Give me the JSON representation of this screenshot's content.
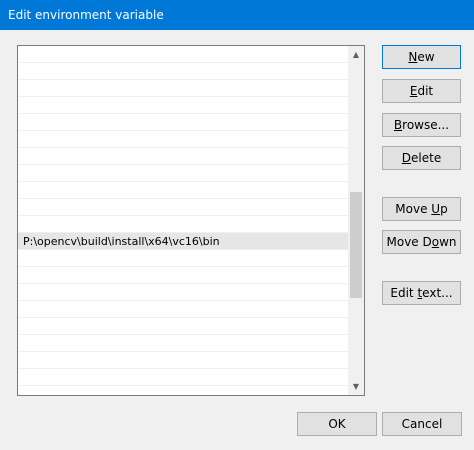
{
  "window": {
    "title": "Edit environment variable"
  },
  "list": {
    "rows": [
      "",
      "",
      "",
      "",
      "",
      "",
      "",
      "",
      "",
      "",
      "",
      "P:\\opencv\\build\\install\\x64\\vc16\\bin",
      "",
      "",
      "",
      "",
      "",
      "",
      "",
      "",
      ""
    ],
    "selected_index": 11
  },
  "buttons": {
    "new": {
      "pre": "",
      "mn": "N",
      "post": "ew"
    },
    "edit": {
      "pre": "",
      "mn": "E",
      "post": "dit"
    },
    "browse": {
      "pre": "",
      "mn": "B",
      "post": "rowse..."
    },
    "delete": {
      "pre": "",
      "mn": "D",
      "post": "elete"
    },
    "move_up": {
      "pre": "Move ",
      "mn": "U",
      "post": "p"
    },
    "move_down": {
      "pre": "Move D",
      "mn": "o",
      "post": "wn"
    },
    "edit_text": {
      "pre": "Edit ",
      "mn": "t",
      "post": "ext..."
    },
    "ok": "OK",
    "cancel": "Cancel"
  },
  "colors": {
    "titlebar": "#0078d7",
    "selection": "#e6e6e6",
    "button_face": "#e1e1e1"
  }
}
